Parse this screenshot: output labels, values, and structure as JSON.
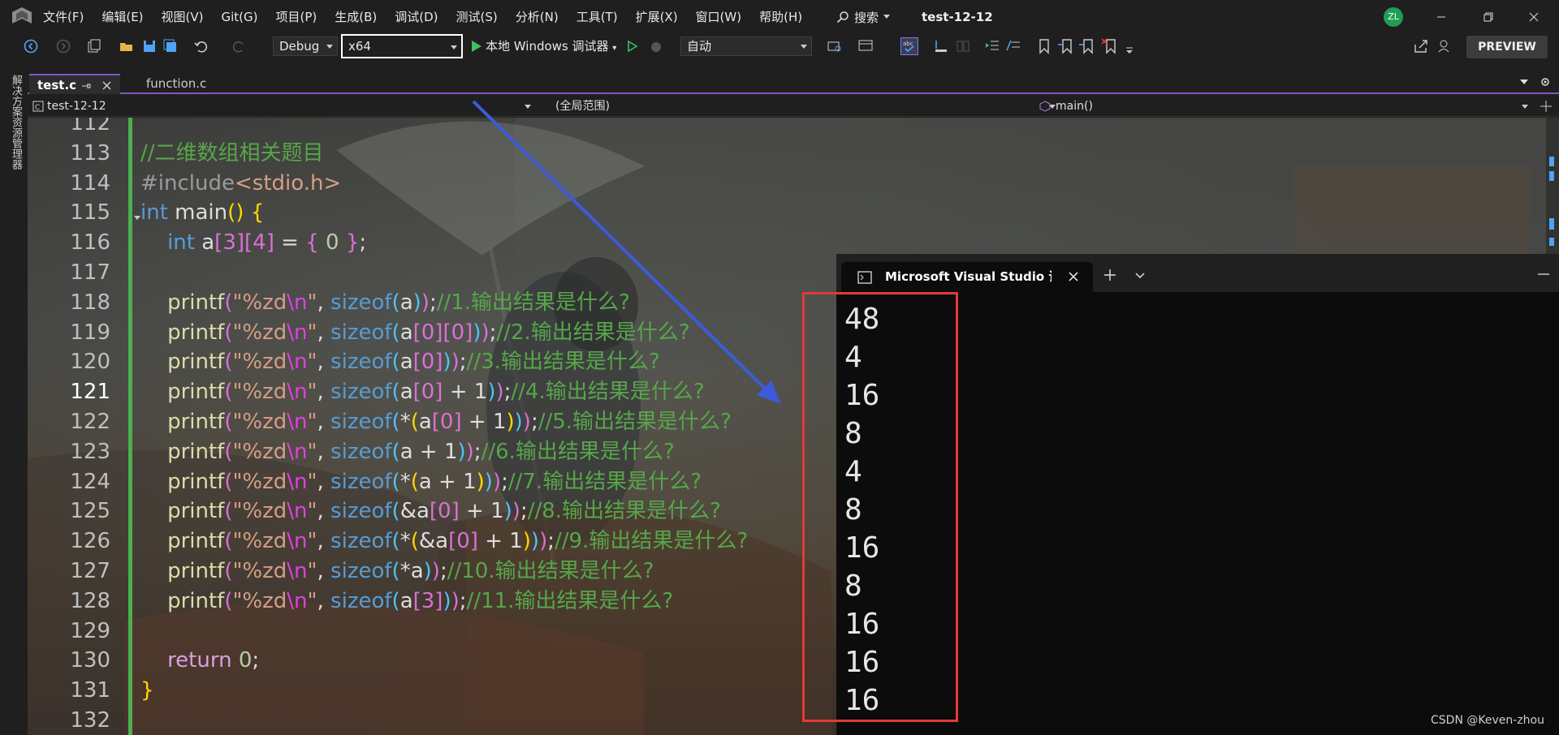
{
  "menubar": {
    "items": [
      "文件(F)",
      "编辑(E)",
      "视图(V)",
      "Git(G)",
      "项目(P)",
      "生成(B)",
      "调试(D)",
      "测试(S)",
      "分析(N)",
      "工具(T)",
      "扩展(X)",
      "窗口(W)",
      "帮助(H)"
    ],
    "search_label": "搜索",
    "solution_title": "test-12-12",
    "avatar_initials": "ZL"
  },
  "toolbar": {
    "configuration": "Debug",
    "platform": "x64",
    "debugger_label": "本地 Windows 调试器",
    "run_mode": "自动",
    "preview_label": "PREVIEW"
  },
  "side_panel": {
    "label": "解决方案资源管理器"
  },
  "tabs": [
    {
      "label": "test.c",
      "active": true
    },
    {
      "label": "function.c",
      "active": false
    }
  ],
  "navbar": {
    "project": "test-12-12",
    "scope": "(全局范围)",
    "member": "main()"
  },
  "editor": {
    "current_line": 121,
    "lines": [
      {
        "num": "112",
        "tokens": []
      },
      {
        "num": "113",
        "tokens": [
          [
            "cm",
            "//二维数组相关题目"
          ]
        ]
      },
      {
        "num": "114",
        "tokens": [
          [
            "pp",
            "#include"
          ],
          [
            "inc",
            "<stdio.h>"
          ]
        ]
      },
      {
        "num": "115",
        "tokens": [
          [
            "kw",
            "int"
          ],
          [
            "id",
            " main"
          ],
          [
            "p1",
            "()"
          ],
          [
            "id",
            " "
          ],
          [
            "p1",
            "{"
          ]
        ]
      },
      {
        "num": "116",
        "tokens": [
          [
            "id",
            "    "
          ],
          [
            "kw",
            "int"
          ],
          [
            "id",
            " a"
          ],
          [
            "p2",
            "[3]"
          ],
          [
            "p2",
            "[4]"
          ],
          [
            "op",
            " = "
          ],
          [
            "p2",
            "{"
          ],
          [
            "num",
            " 0 "
          ],
          [
            "p2",
            "}"
          ],
          [
            "op",
            ";"
          ]
        ]
      },
      {
        "num": "117",
        "tokens": []
      },
      {
        "num": "118",
        "tokens": [
          [
            "id",
            "    "
          ],
          [
            "fn",
            "printf"
          ],
          [
            "p2",
            "("
          ],
          [
            "str",
            "\"%zd"
          ],
          [
            "esc",
            "\\n"
          ],
          [
            "str",
            "\""
          ],
          [
            "op",
            ", "
          ],
          [
            "kw",
            "sizeof"
          ],
          [
            "p3",
            "("
          ],
          [
            "id",
            "a"
          ],
          [
            "p3",
            ")"
          ],
          [
            "p2",
            ")"
          ],
          [
            "op",
            ";"
          ],
          [
            "cm",
            "//1.输出结果是什么?"
          ]
        ]
      },
      {
        "num": "119",
        "tokens": [
          [
            "id",
            "    "
          ],
          [
            "fn",
            "printf"
          ],
          [
            "p2",
            "("
          ],
          [
            "str",
            "\"%zd"
          ],
          [
            "esc",
            "\\n"
          ],
          [
            "str",
            "\""
          ],
          [
            "op",
            ", "
          ],
          [
            "kw",
            "sizeof"
          ],
          [
            "p3",
            "("
          ],
          [
            "id",
            "a"
          ],
          [
            "p2",
            "[0]"
          ],
          [
            "p2",
            "[0]"
          ],
          [
            "p3",
            ")"
          ],
          [
            "p2",
            ")"
          ],
          [
            "op",
            ";"
          ],
          [
            "cm",
            "//2.输出结果是什么?"
          ]
        ]
      },
      {
        "num": "120",
        "tokens": [
          [
            "id",
            "    "
          ],
          [
            "fn",
            "printf"
          ],
          [
            "p2",
            "("
          ],
          [
            "str",
            "\"%zd"
          ],
          [
            "esc",
            "\\n"
          ],
          [
            "str",
            "\""
          ],
          [
            "op",
            ", "
          ],
          [
            "kw",
            "sizeof"
          ],
          [
            "p3",
            "("
          ],
          [
            "id",
            "a"
          ],
          [
            "p2",
            "[0]"
          ],
          [
            "p3",
            ")"
          ],
          [
            "p2",
            ")"
          ],
          [
            "op",
            ";"
          ],
          [
            "cm",
            "//3.输出结果是什么?"
          ]
        ]
      },
      {
        "num": "121",
        "tokens": [
          [
            "id",
            "    "
          ],
          [
            "fn",
            "printf"
          ],
          [
            "p2",
            "("
          ],
          [
            "str",
            "\"%zd"
          ],
          [
            "esc",
            "\\n"
          ],
          [
            "str",
            "\""
          ],
          [
            "op",
            ", "
          ],
          [
            "kw",
            "sizeof"
          ],
          [
            "p3",
            "("
          ],
          [
            "id",
            "a"
          ],
          [
            "p2",
            "[0]"
          ],
          [
            "op",
            " + 1"
          ],
          [
            "p3",
            ")"
          ],
          [
            "p2",
            ")"
          ],
          [
            "op",
            ";"
          ],
          [
            "cm",
            "//4.输出结果是什么?"
          ]
        ]
      },
      {
        "num": "122",
        "tokens": [
          [
            "id",
            "    "
          ],
          [
            "fn",
            "printf"
          ],
          [
            "p2",
            "("
          ],
          [
            "str",
            "\"%zd"
          ],
          [
            "esc",
            "\\n"
          ],
          [
            "str",
            "\""
          ],
          [
            "op",
            ", "
          ],
          [
            "kw",
            "sizeof"
          ],
          [
            "p3",
            "("
          ],
          [
            "op",
            "*"
          ],
          [
            "p1",
            "("
          ],
          [
            "id",
            "a"
          ],
          [
            "p2",
            "[0]"
          ],
          [
            "op",
            " + 1"
          ],
          [
            "p1",
            ")"
          ],
          [
            "p3",
            ")"
          ],
          [
            "p2",
            ")"
          ],
          [
            "op",
            ";"
          ],
          [
            "cm",
            "//5.输出结果是什么?"
          ]
        ]
      },
      {
        "num": "123",
        "tokens": [
          [
            "id",
            "    "
          ],
          [
            "fn",
            "printf"
          ],
          [
            "p2",
            "("
          ],
          [
            "str",
            "\"%zd"
          ],
          [
            "esc",
            "\\n"
          ],
          [
            "str",
            "\""
          ],
          [
            "op",
            ", "
          ],
          [
            "kw",
            "sizeof"
          ],
          [
            "p3",
            "("
          ],
          [
            "id",
            "a"
          ],
          [
            "op",
            " + 1"
          ],
          [
            "p3",
            ")"
          ],
          [
            "p2",
            ")"
          ],
          [
            "op",
            ";"
          ],
          [
            "cm",
            "//6.输出结果是什么?"
          ]
        ]
      },
      {
        "num": "124",
        "tokens": [
          [
            "id",
            "    "
          ],
          [
            "fn",
            "printf"
          ],
          [
            "p2",
            "("
          ],
          [
            "str",
            "\"%zd"
          ],
          [
            "esc",
            "\\n"
          ],
          [
            "str",
            "\""
          ],
          [
            "op",
            ", "
          ],
          [
            "kw",
            "sizeof"
          ],
          [
            "p3",
            "("
          ],
          [
            "op",
            "*"
          ],
          [
            "p1",
            "("
          ],
          [
            "id",
            "a"
          ],
          [
            "op",
            " + 1"
          ],
          [
            "p1",
            ")"
          ],
          [
            "p3",
            ")"
          ],
          [
            "p2",
            ")"
          ],
          [
            "op",
            ";"
          ],
          [
            "cm",
            "//7.输出结果是什么?"
          ]
        ]
      },
      {
        "num": "125",
        "tokens": [
          [
            "id",
            "    "
          ],
          [
            "fn",
            "printf"
          ],
          [
            "p2",
            "("
          ],
          [
            "str",
            "\"%zd"
          ],
          [
            "esc",
            "\\n"
          ],
          [
            "str",
            "\""
          ],
          [
            "op",
            ", "
          ],
          [
            "kw",
            "sizeof"
          ],
          [
            "p3",
            "("
          ],
          [
            "op",
            "&"
          ],
          [
            "id",
            "a"
          ],
          [
            "p2",
            "[0]"
          ],
          [
            "op",
            " + 1"
          ],
          [
            "p3",
            ")"
          ],
          [
            "p2",
            ")"
          ],
          [
            "op",
            ";"
          ],
          [
            "cm",
            "//8.输出结果是什么?"
          ]
        ]
      },
      {
        "num": "126",
        "tokens": [
          [
            "id",
            "    "
          ],
          [
            "fn",
            "printf"
          ],
          [
            "p2",
            "("
          ],
          [
            "str",
            "\"%zd"
          ],
          [
            "esc",
            "\\n"
          ],
          [
            "str",
            "\""
          ],
          [
            "op",
            ", "
          ],
          [
            "kw",
            "sizeof"
          ],
          [
            "p3",
            "("
          ],
          [
            "op",
            "*"
          ],
          [
            "p1",
            "("
          ],
          [
            "op",
            "&"
          ],
          [
            "id",
            "a"
          ],
          [
            "p2",
            "[0]"
          ],
          [
            "op",
            " + 1"
          ],
          [
            "p1",
            ")"
          ],
          [
            "p3",
            ")"
          ],
          [
            "p2",
            ")"
          ],
          [
            "op",
            ";"
          ],
          [
            "cm",
            "//9.输出结果是什么?"
          ]
        ]
      },
      {
        "num": "127",
        "tokens": [
          [
            "id",
            "    "
          ],
          [
            "fn",
            "printf"
          ],
          [
            "p2",
            "("
          ],
          [
            "str",
            "\"%zd"
          ],
          [
            "esc",
            "\\n"
          ],
          [
            "str",
            "\""
          ],
          [
            "op",
            ", "
          ],
          [
            "kw",
            "sizeof"
          ],
          [
            "p3",
            "("
          ],
          [
            "op",
            "*"
          ],
          [
            "id",
            "a"
          ],
          [
            "p3",
            ")"
          ],
          [
            "p2",
            ")"
          ],
          [
            "op",
            ";"
          ],
          [
            "cm",
            "//10.输出结果是什么?"
          ]
        ]
      },
      {
        "num": "128",
        "tokens": [
          [
            "id",
            "    "
          ],
          [
            "fn",
            "printf"
          ],
          [
            "p2",
            "("
          ],
          [
            "str",
            "\"%zd"
          ],
          [
            "esc",
            "\\n"
          ],
          [
            "str",
            "\""
          ],
          [
            "op",
            ", "
          ],
          [
            "kw",
            "sizeof"
          ],
          [
            "p3",
            "("
          ],
          [
            "id",
            "a"
          ],
          [
            "p2",
            "[3]"
          ],
          [
            "p3",
            ")"
          ],
          [
            "p2",
            ")"
          ],
          [
            "op",
            ";"
          ],
          [
            "cm",
            "//11.输出结果是什么?"
          ]
        ]
      },
      {
        "num": "129",
        "tokens": []
      },
      {
        "num": "130",
        "tokens": [
          [
            "id",
            "    "
          ],
          [
            "ret",
            "return"
          ],
          [
            "num",
            " 0"
          ],
          [
            "op",
            ";"
          ]
        ]
      },
      {
        "num": "131",
        "tokens": [
          [
            "p1",
            "}"
          ]
        ]
      },
      {
        "num": "132",
        "tokens": []
      }
    ]
  },
  "terminal": {
    "title": "Microsoft Visual Studio 调试控制台",
    "output": [
      "48",
      "4",
      "16",
      "8",
      "4",
      "8",
      "16",
      "8",
      "16",
      "16",
      "16"
    ]
  },
  "watermark": "CSDN @Keven-zhou",
  "colors": {
    "accent": "#7e57c2",
    "annotation_box": "#e53935",
    "annotation_arrow": "#3b5bdb",
    "change_bar": "#4caf50"
  }
}
